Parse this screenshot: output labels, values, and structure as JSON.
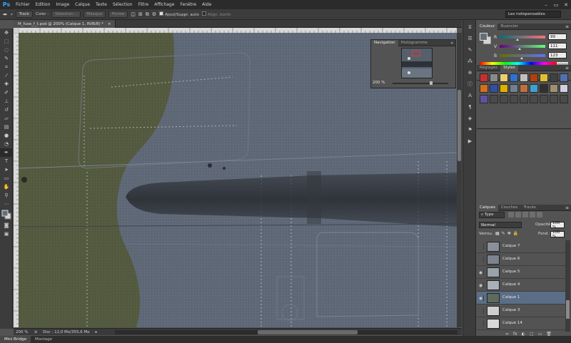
{
  "app": {
    "logo": "Ps"
  },
  "menu": [
    "Fichier",
    "Edition",
    "Image",
    "Calque",
    "Texte",
    "Sélection",
    "Filtre",
    "Affichage",
    "Fenêtre",
    "Aide"
  ],
  "window_controls": [
    "–",
    "▭",
    "✕"
  ],
  "options": {
    "track": "Track",
    "color_label": "Color :",
    "select": "Sélection...",
    "mask": "Masque",
    "shape": "Forme",
    "auto_label": "Ajout/Suppr. auto",
    "align_label": "Align. bords",
    "workspace": "Les indispensables"
  },
  "document": {
    "tab_title": "M_fuse_f_t.psd @ 200% (Calque 1, RVB/8) *",
    "close": "×",
    "zoom": "200 %",
    "doc_info": "Doc : 12,0 Mo/355,6 Mo"
  },
  "navigator": {
    "tabs": [
      "Navigation",
      "Histogramme"
    ],
    "zoom": "200 %",
    "menu": "»"
  },
  "color": {
    "tabs": [
      "Couleur",
      "Nuancier"
    ],
    "r": {
      "label": "R",
      "value": "99",
      "fraction": 0.39
    },
    "g": {
      "label": "V",
      "value": "111",
      "fraction": 0.44
    },
    "b": {
      "label": "B",
      "value": "123",
      "fraction": 0.48
    },
    "fg": "#63707b"
  },
  "styles": {
    "tabs": [
      "Réglages",
      "Styles"
    ],
    "swatches": [
      "#c83030",
      "#8a8a8a",
      "#e8d070",
      "#3070d0",
      "#c0c0c0",
      "#b04010",
      "#e0c030",
      "#404040",
      "#5070b0",
      "#d07020",
      "#3050a0",
      "#e0b000",
      "#708090",
      "#c07040",
      "#40a0d0",
      "#303030",
      "#a09070",
      "#d0d0e0",
      "#6050a0",
      "#4a4a4a",
      "#4a4a4a",
      "#4a4a4a",
      "#4a4a4a",
      "#4a4a4a",
      "#4a4a4a",
      "#4a4a4a",
      "#4a4a4a"
    ]
  },
  "layers": {
    "tabs": [
      "Calques",
      "Couches",
      "Tracés"
    ],
    "filter": "⌕ Type",
    "blend_mode": "Normal",
    "opacity_label": "Opacité :",
    "opacity": "100 %",
    "lock_label": "Verrou. :",
    "fill_label": "Fond :",
    "fill": "100 %",
    "items": [
      {
        "name": "Calque 7",
        "visible": false,
        "selected": false,
        "thumb": "#8a9099"
      },
      {
        "name": "Calque 6",
        "visible": false,
        "selected": false,
        "thumb": "#7c848e"
      },
      {
        "name": "Calque 5",
        "visible": true,
        "selected": false,
        "thumb": "#9aa2aa"
      },
      {
        "name": "Calque 4",
        "visible": true,
        "selected": false,
        "thumb": "#a8b0b8"
      },
      {
        "name": "Calque 1",
        "visible": true,
        "selected": true,
        "thumb": "#5e6a5c"
      },
      {
        "name": "Calque 3",
        "visible": false,
        "selected": false,
        "thumb": "#cfcfcf"
      },
      {
        "name": "Calque 14",
        "visible": false,
        "selected": false,
        "thumb": "#d8d8d8"
      }
    ],
    "bottom_icons": [
      "∞",
      "fx",
      "◐",
      "▢",
      "▭",
      "🗑"
    ]
  },
  "bottom_tabs": [
    "Mini Bridge",
    "Montage"
  ]
}
